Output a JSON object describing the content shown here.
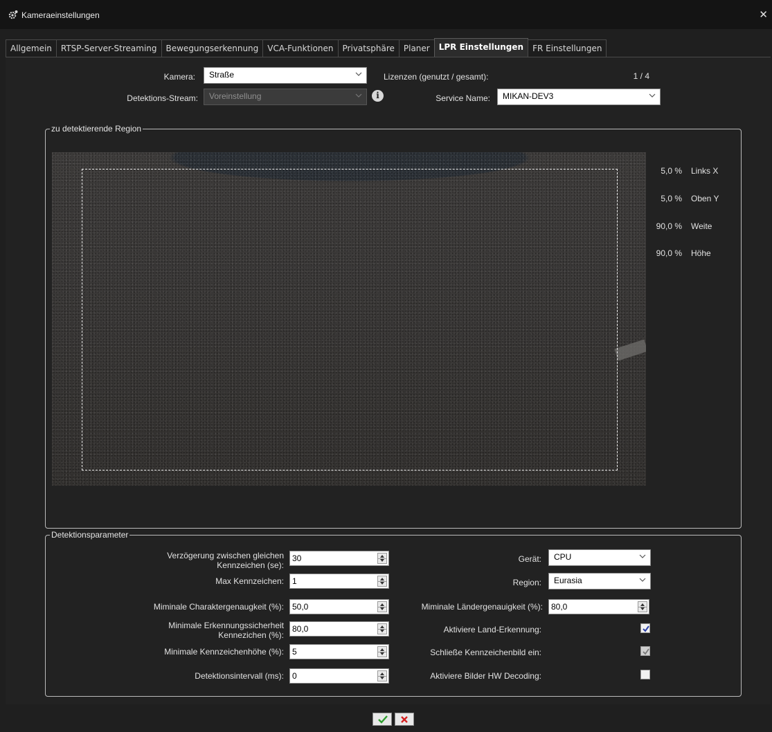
{
  "window": {
    "title": "Kameraeinstellungen",
    "close_glyph": "✕",
    "title_icon": "gear-camera-icon"
  },
  "tabs": [
    {
      "label": "Allgemein",
      "active": false
    },
    {
      "label": "RTSP-Server-Streaming",
      "active": false
    },
    {
      "label": "Bewegungserkennung",
      "active": false
    },
    {
      "label": "VCA-Funktionen",
      "active": false
    },
    {
      "label": "Privatsphäre",
      "active": false
    },
    {
      "label": "Planer",
      "active": false
    },
    {
      "label": "LPR Einstellungen",
      "active": true
    },
    {
      "label": "FR Einstellungen",
      "active": false
    }
  ],
  "top": {
    "camera_label": "Kamera:",
    "camera_value": "Straße",
    "stream_label": "Detektions-Stream:",
    "stream_value": "Voreinstellung",
    "licenses_label": "Lizenzen (genutzt / gesamt):",
    "licenses_value": "1 / 4",
    "service_label": "Service Name:",
    "service_value": "MIKAN-DEV3"
  },
  "region": {
    "title": "zu detektierende Region",
    "fields": [
      {
        "value": "5,0 %",
        "name": "Links X"
      },
      {
        "value": "5,0 %",
        "name": "Oben Y"
      },
      {
        "value": "90,0 %",
        "name": "Weite"
      },
      {
        "value": "90,0 %",
        "name": "Höhe"
      }
    ]
  },
  "params": {
    "title": "Detektionsparameter",
    "left": [
      {
        "label_line1": "Verzögerung zwischen gleichen",
        "label_line2": "Kennzeichen (se):",
        "value": "30"
      },
      {
        "label_line1": "Max Kennzeichen:",
        "label_line2": "",
        "value": "1"
      },
      {
        "label_line1": "Miminale Charaktergenaugkeit (%):",
        "label_line2": "",
        "value": "50,0"
      },
      {
        "label_line1": "Minimale Erkennungssicherheit",
        "label_line2": "Kennezichen (%):",
        "value": "80,0"
      },
      {
        "label_line1": "Minimale Kennzeichenhöhe (%):",
        "label_line2": "",
        "value": "5"
      },
      {
        "label_line1": "Detektionsintervall (ms):",
        "label_line2": "",
        "value": "0"
      }
    ],
    "device_label": "Gerät:",
    "device_value": "CPU",
    "region_label": "Region:",
    "region_value": "Eurasia",
    "country_acc_label": "Miminale Ländergenauigkeit (%):",
    "country_acc_value": "80,0",
    "checks": [
      {
        "label": "Aktiviere Land-Erkennung:",
        "checked": true,
        "enabled": true
      },
      {
        "label": "Schließe Kennzeichenbild ein:",
        "checked": true,
        "enabled": false
      },
      {
        "label": "Aktiviere Bilder HW Decoding:",
        "checked": false,
        "enabled": true
      }
    ]
  },
  "footer": {
    "ok_icon": "check-icon",
    "cancel_icon": "x-icon",
    "ok_color": "#2e9e2e",
    "cancel_color": "#d42020"
  }
}
